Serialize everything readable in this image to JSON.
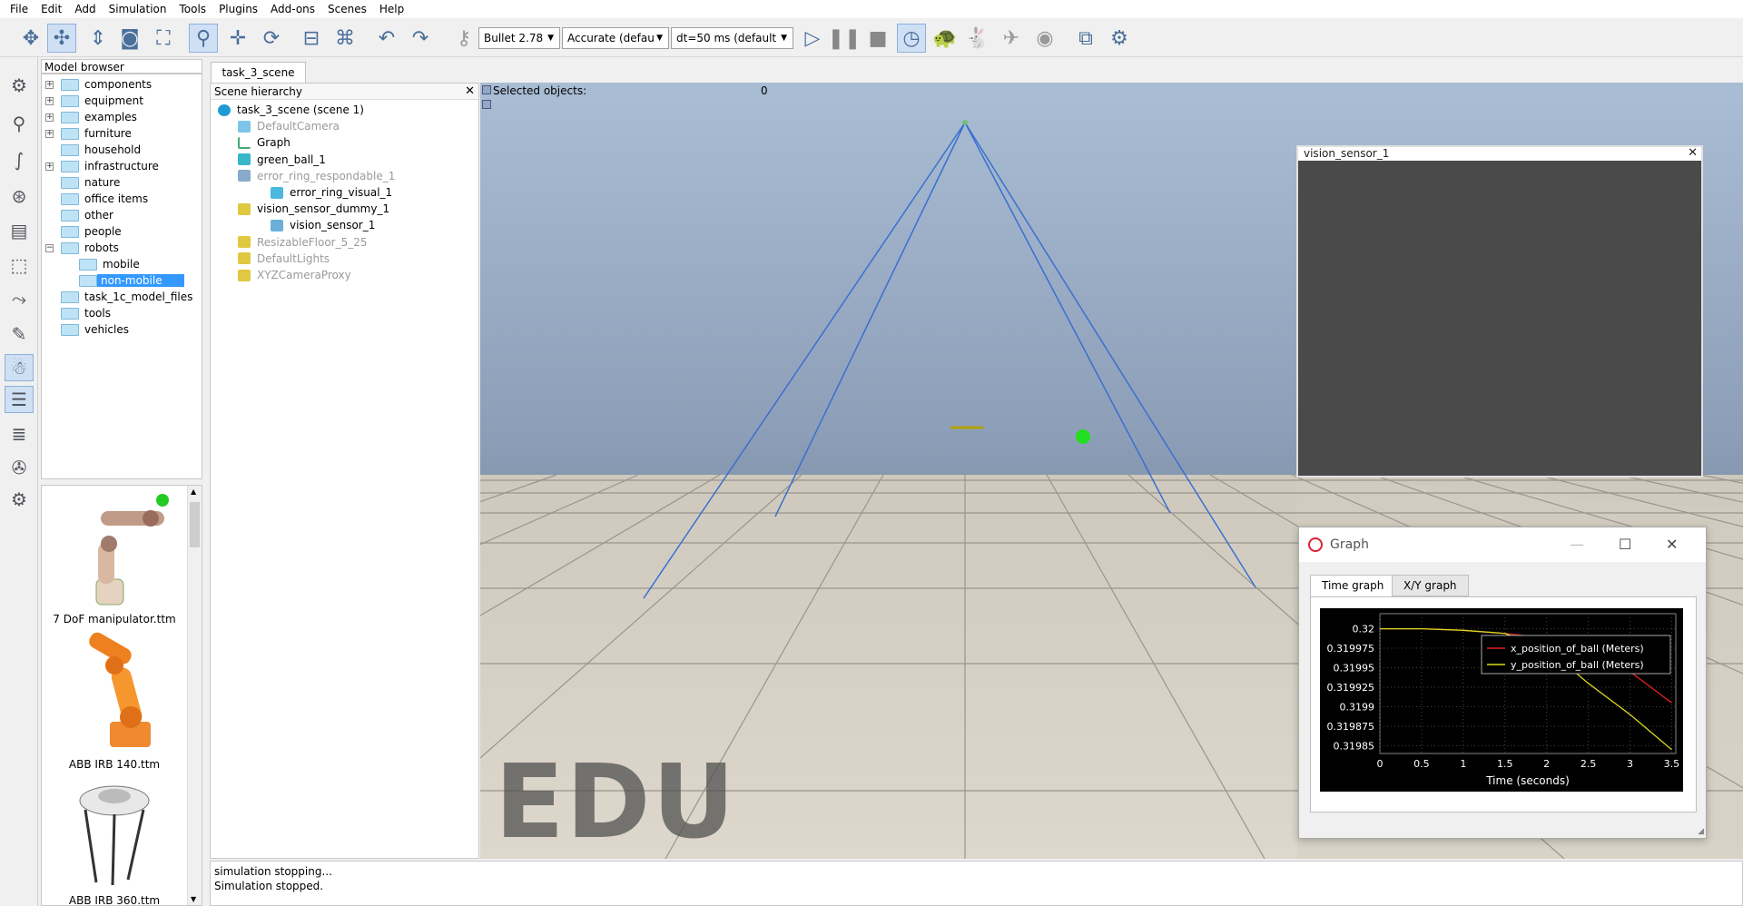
{
  "menu": [
    "File",
    "Edit",
    "Add",
    "Simulation",
    "Tools",
    "Plugins",
    "Add-ons",
    "Scenes",
    "Help"
  ],
  "toolbar": {
    "engine": "Bullet 2.78",
    "accuracy": "Accurate (defau",
    "timestep": "dt=50 ms (default"
  },
  "model_browser": {
    "title": "Model browser",
    "items": [
      {
        "label": "components",
        "expandable": true
      },
      {
        "label": "equipment",
        "expandable": true
      },
      {
        "label": "examples",
        "expandable": true
      },
      {
        "label": "furniture",
        "expandable": true
      },
      {
        "label": "household",
        "expandable": false
      },
      {
        "label": "infrastructure",
        "expandable": true
      },
      {
        "label": "nature",
        "expandable": false
      },
      {
        "label": "office items",
        "expandable": false
      },
      {
        "label": "other",
        "expandable": false
      },
      {
        "label": "people",
        "expandable": false
      },
      {
        "label": "robots",
        "expandable": true
      },
      {
        "label": "mobile",
        "child": true
      },
      {
        "label": "non-mobile",
        "child": true,
        "selected": true
      },
      {
        "label": "task_1c_model_files",
        "expandable": false
      },
      {
        "label": "tools",
        "expandable": false
      },
      {
        "label": "vehicles",
        "expandable": false
      }
    ],
    "thumbnails": [
      "7 DoF manipulator.ttm",
      "ABB IRB 140.ttm",
      "ABB IRB 360.ttm"
    ]
  },
  "scene_tab": "task_3_scene",
  "hierarchy": {
    "title": "Scene hierarchy",
    "rows": [
      {
        "label": "task_3_scene (scene 1)",
        "indent": 0,
        "gray": false
      },
      {
        "label": "DefaultCamera",
        "indent": 1,
        "gray": true
      },
      {
        "label": "Graph",
        "indent": 1,
        "gray": false
      },
      {
        "label": "green_ball_1",
        "indent": 1,
        "gray": false
      },
      {
        "label": "error_ring_respondable_1",
        "indent": 1,
        "gray": true
      },
      {
        "label": "error_ring_visual_1",
        "indent": 2,
        "gray": false
      },
      {
        "label": "vision_sensor_dummy_1",
        "indent": 1,
        "gray": false
      },
      {
        "label": "vision_sensor_1",
        "indent": 2,
        "gray": false
      },
      {
        "label": "ResizableFloor_5_25",
        "indent": 1,
        "gray": true
      },
      {
        "label": "DefaultLights",
        "indent": 1,
        "gray": true
      },
      {
        "label": "XYZCameraProxy",
        "indent": 1,
        "gray": true
      }
    ]
  },
  "viewport": {
    "selected_label": "Selected objects:",
    "selected_count": "0",
    "watermark": "EDU",
    "vision_window_title": "vision_sensor_1"
  },
  "graph_window": {
    "title": "Graph",
    "tabs": [
      "Time graph",
      "X/Y graph"
    ]
  },
  "chart_data": {
    "type": "line",
    "xlabel": "Time (seconds)",
    "x_ticks": [
      "0",
      "0.5",
      "1",
      "1.5",
      "2",
      "2.5",
      "3",
      "3.5"
    ],
    "y_ticks": [
      "0.32",
      "0.319975",
      "0.31995",
      "0.319925",
      "0.3199",
      "0.319875",
      "0.31985"
    ],
    "xlim": [
      0,
      3.55
    ],
    "ylim": [
      0.31984,
      0.32001
    ],
    "series": [
      {
        "name": "x_position_of_ball (Meters)",
        "color": "#e02020",
        "x": [
          0,
          0.5,
          1,
          1.5,
          2,
          2.5,
          3,
          3.5
        ],
        "y": [
          0.32,
          0.32,
          0.319998,
          0.319994,
          0.319988,
          0.31997,
          0.319945,
          0.319905
        ]
      },
      {
        "name": "y_position_of_ball (Meters)",
        "color": "#d8d820",
        "x": [
          0,
          0.5,
          1,
          1.5,
          2,
          2.5,
          3,
          3.5
        ],
        "y": [
          0.32,
          0.32,
          0.319998,
          0.319994,
          0.319975,
          0.31993,
          0.31989,
          0.319845
        ]
      }
    ]
  },
  "console": [
    "simulation stopping...",
    "Simulation stopped."
  ]
}
